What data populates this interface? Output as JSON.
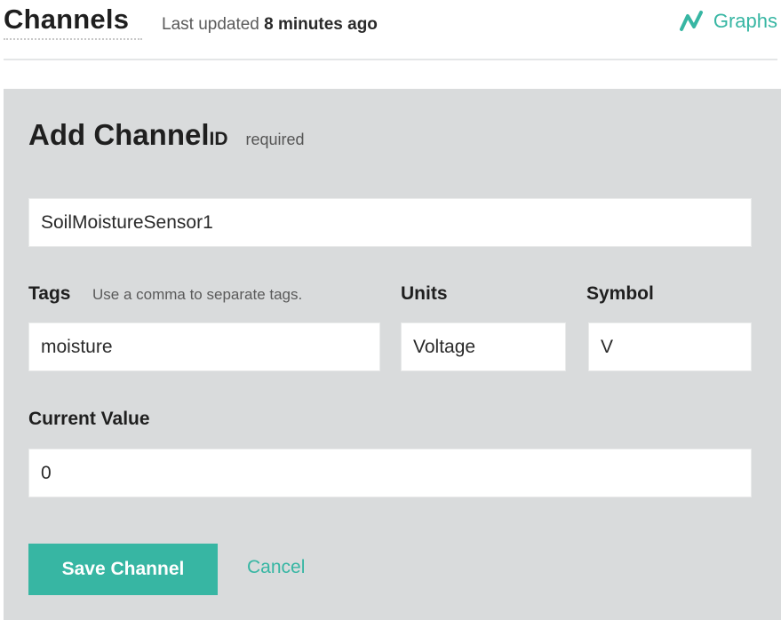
{
  "header": {
    "title": "Channels",
    "updated_prefix": "Last updated",
    "updated_time": "8 minutes ago",
    "graphs_label": "Graphs",
    "graphs_icon": "graph-line-icon"
  },
  "form": {
    "title": "Add Channel",
    "id_label": "ID",
    "required_label": "required",
    "channel_id_value": "SoilMoistureSensor1",
    "tags_label": "Tags",
    "tags_hint": "Use a comma to separate tags.",
    "tags_value": "moisture",
    "units_label": "Units",
    "units_value": "Voltage",
    "symbol_label": "Symbol",
    "symbol_value": "V",
    "current_value_label": "Current Value",
    "current_value": "0",
    "save_label": "Save Channel",
    "cancel_label": "Cancel"
  },
  "colors": {
    "accent": "#37b6a3",
    "panel_background": "#d9dbdc",
    "field_background": "#ffffff"
  }
}
